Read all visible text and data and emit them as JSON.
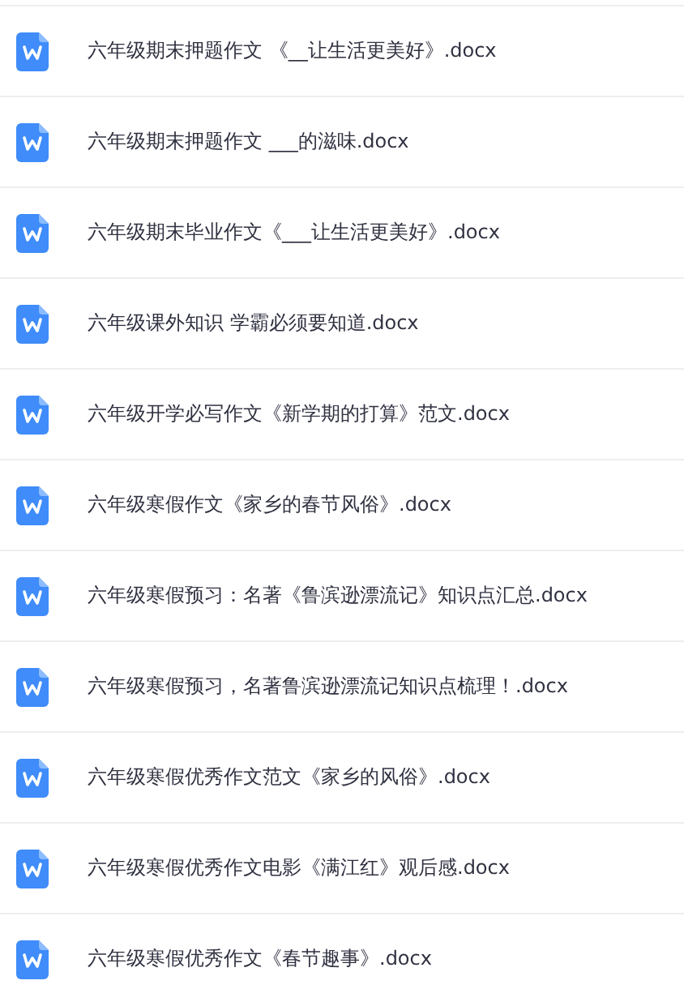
{
  "files": [
    {
      "name": "六年级期末押题作文 《__让生活更美好》.docx"
    },
    {
      "name": "六年级期末押题作文 ___的滋味.docx"
    },
    {
      "name": "六年级期末毕业作文《___让生活更美好》.docx"
    },
    {
      "name": "六年级课外知识 学霸必须要知道.docx"
    },
    {
      "name": "六年级开学必写作文《新学期的打算》范文.docx"
    },
    {
      "name": "六年级寒假作文《家乡的春节风俗》.docx"
    },
    {
      "name": "六年级寒假预习：名著《鲁滨逊漂流记》知识点汇总.docx"
    },
    {
      "name": "六年级寒假预习，名著鲁滨逊漂流记知识点梳理！.docx"
    },
    {
      "name": "六年级寒假优秀作文范文《家乡的风俗》.docx"
    },
    {
      "name": "六年级寒假优秀作文电影《满江红》观后感.docx"
    },
    {
      "name": "六年级寒假优秀作文《春节趣事》.docx"
    }
  ]
}
